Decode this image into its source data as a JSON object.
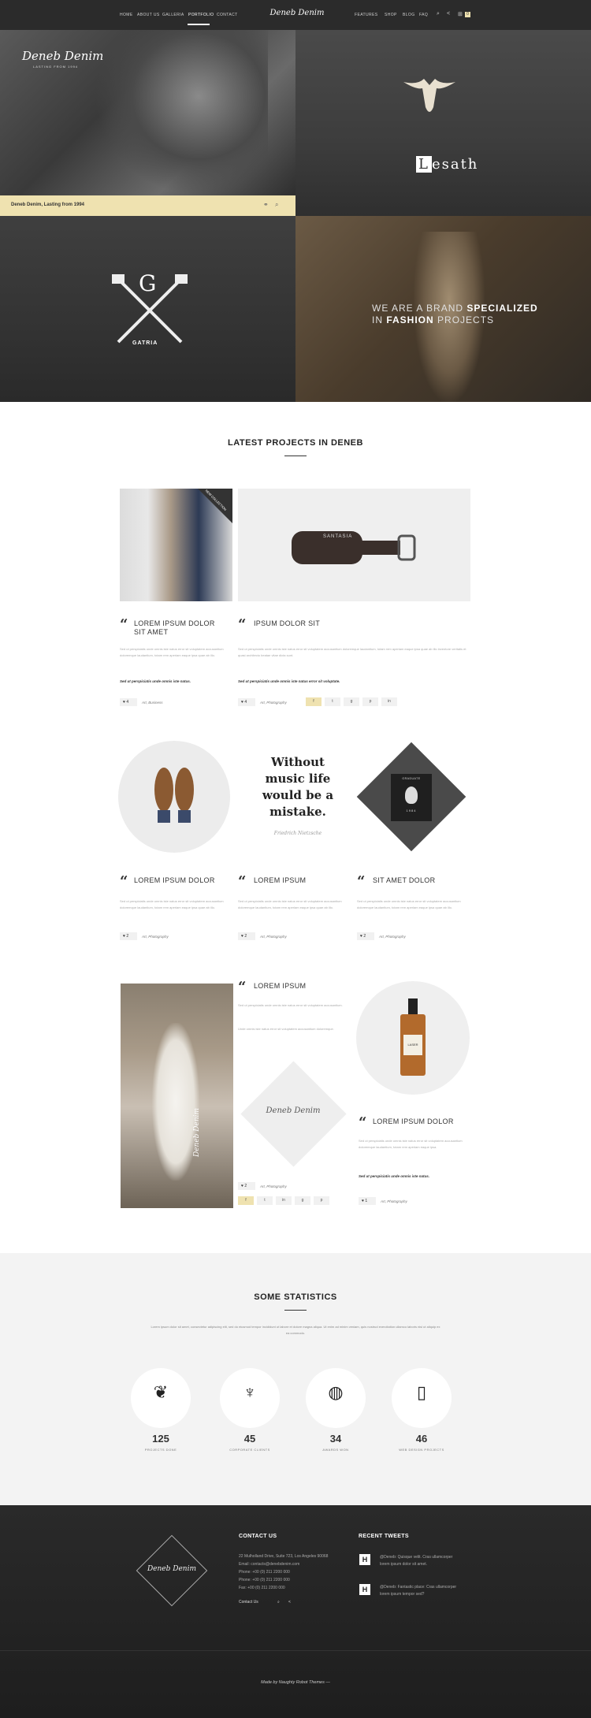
{
  "nav": {
    "left": [
      "HOME",
      "ABOUT US",
      "GALLERIA",
      "PORTFOLIO",
      "CONTACT"
    ],
    "logo": "Deneb Denim",
    "right": [
      "FEATURES",
      "SHOP",
      "BLOG",
      "FAQ"
    ],
    "cart_count": "0"
  },
  "hero": {
    "logo_script": "Deneb Denim",
    "logo_sub": "LASTING FROM 1994",
    "band_text": "Deneb Denim, Lasting from 1994",
    "lesath_L": "L",
    "lesath_rest": "esath",
    "gatria_letter": "G",
    "gatria_name": "GATRIA",
    "tagline_pre": "WE ARE A BRAND ",
    "tagline_bold1": "SPECIALIZED",
    "tagline_mid": "IN ",
    "tagline_bold2": "FASHION",
    "tagline_post": " PROJECTS"
  },
  "projects": {
    "title": "LATEST PROJECTS IN DENEB",
    "ribbon": "NEW COLLECTION",
    "bottle_label": "SANTASIA",
    "cards": [
      {
        "title": "LOREM IPSUM DOLOR SIT AMET",
        "text": "Sed ut perspiciatis unde omnis iste natus error sit voluptatem accusantium doloremque laudantium, totam rem aperiam eaque ipsa quae ab illo.",
        "ital": "Sed ut perspiciatis unde omnis iste natus.",
        "likes": "4",
        "cat": "Art, Business"
      },
      {
        "title": "IPSUM DOLOR SIT",
        "text": "Sed ut perspiciatis unde omnis iste natus error sit voluptatem accusantium doloremque laudantium, totam rem aperiam eaque ipsa quae ab illo inventore veritatis et quasi architecto beatae vitae dicta sunt.",
        "ital": "Sed ut perspiciatis unde omnis iste natus error sit voluptate.",
        "likes": "4",
        "cat": "Art, Photography"
      },
      {
        "title": "LOREM IPSUM DOLOR",
        "text": "Sed ut perspiciatis unde omnis iste natus error sit voluptatem accusantium doloremque laudantium, totam rem aperiam eaque ipsa quae ab illo.",
        "likes": "2",
        "cat": "Art, Photography"
      },
      {
        "title": "LOREM IPSUM",
        "text": "Sed ut perspiciatis unde omnis iste natus error sit voluptatem accusantium doloremque laudantium, totam rem aperiam eaque ipsa quae ab illo.",
        "likes": "2",
        "cat": "Art, Photography"
      },
      {
        "title": "SIT AMET DOLOR",
        "text": "Sed ut perspiciatis unde omnis iste natus error sit voluptatem accusantium doloremque laudantium, totam rem aperiam eaque ipsa quae ab illo.",
        "likes": "2",
        "cat": "Art, Photography"
      },
      {
        "title": "LOREM IPSUM",
        "text": "Sed ut perspiciatis unde omnis iste natus error sit voluptatem accusantium.",
        "text2": "Unde omnis iste natus error sit voluptatem accusantium doloremque.",
        "likes": "2",
        "cat": "Art, Photography"
      },
      {
        "title": "LOREM IPSUM DOLOR",
        "text": "Sed ut perspiciatis unde omnis iste natus error sit voluptatem accusantium doloremque laudantium, totam rem aperiam eaque ipsa.",
        "ital": "Sed ut perspiciatis unde omnis iste natus.",
        "likes": "1",
        "cat": "Art, Photography"
      }
    ],
    "quote_text": "Without music life would be a mistake.",
    "quote_author": "Friedrich Nietzsche",
    "badge_text": "GRADUATE",
    "badge_year": "1984",
    "wedding_script": "Deneb Denim",
    "diamond_logo": "Deneb Denim",
    "whiskey_label": "LASER"
  },
  "stats": {
    "title": "SOME STATISTICS",
    "intro": "Lorem ipsum dolor sit amet, consectetur adipiscing elit, sed do eiusmod tempor incididunt ut labore et dolore magna aliqua. Ut enim ad minim veniam, quis nostrud exercitation ullamco laboris nisi ut aliquip ex ea commodo.",
    "items": [
      {
        "num": "125",
        "label": "PROJECTS DONE",
        "icon": "laurel-icon"
      },
      {
        "num": "45",
        "label": "CORPORATE CLIENTS",
        "icon": "deer-icon"
      },
      {
        "num": "34",
        "label": "AWARDS WON",
        "icon": "globe-icon"
      },
      {
        "num": "46",
        "label": "WEB DESIGN PROJECTS",
        "icon": "phone-icon"
      }
    ]
  },
  "footer": {
    "logo": "Deneb Denim",
    "contact_head": "CONTACT US",
    "contact_lines": [
      "22 Mulholland Drive, Suite 723, Los Angeles 90068",
      "Email: contacts@denebdenim.com",
      "Phone: +00 (0) 211 2200 000",
      "Phone: +00 (0) 211 2200 000",
      "Fax: +00 (0) 211 2200 000"
    ],
    "contact_link": "Contact Us",
    "tweets_head": "RECENT TWEETS",
    "tweets": [
      "@Deneb: Quisque velit. Cras ullamcorper lorem ipsum dolor sit amet.",
      "@Deneb: Fantastic place: Cras ullamcorper lorem ipsum tempor sed?"
    ],
    "made_by": "Made by Naughty Robot Themes"
  }
}
